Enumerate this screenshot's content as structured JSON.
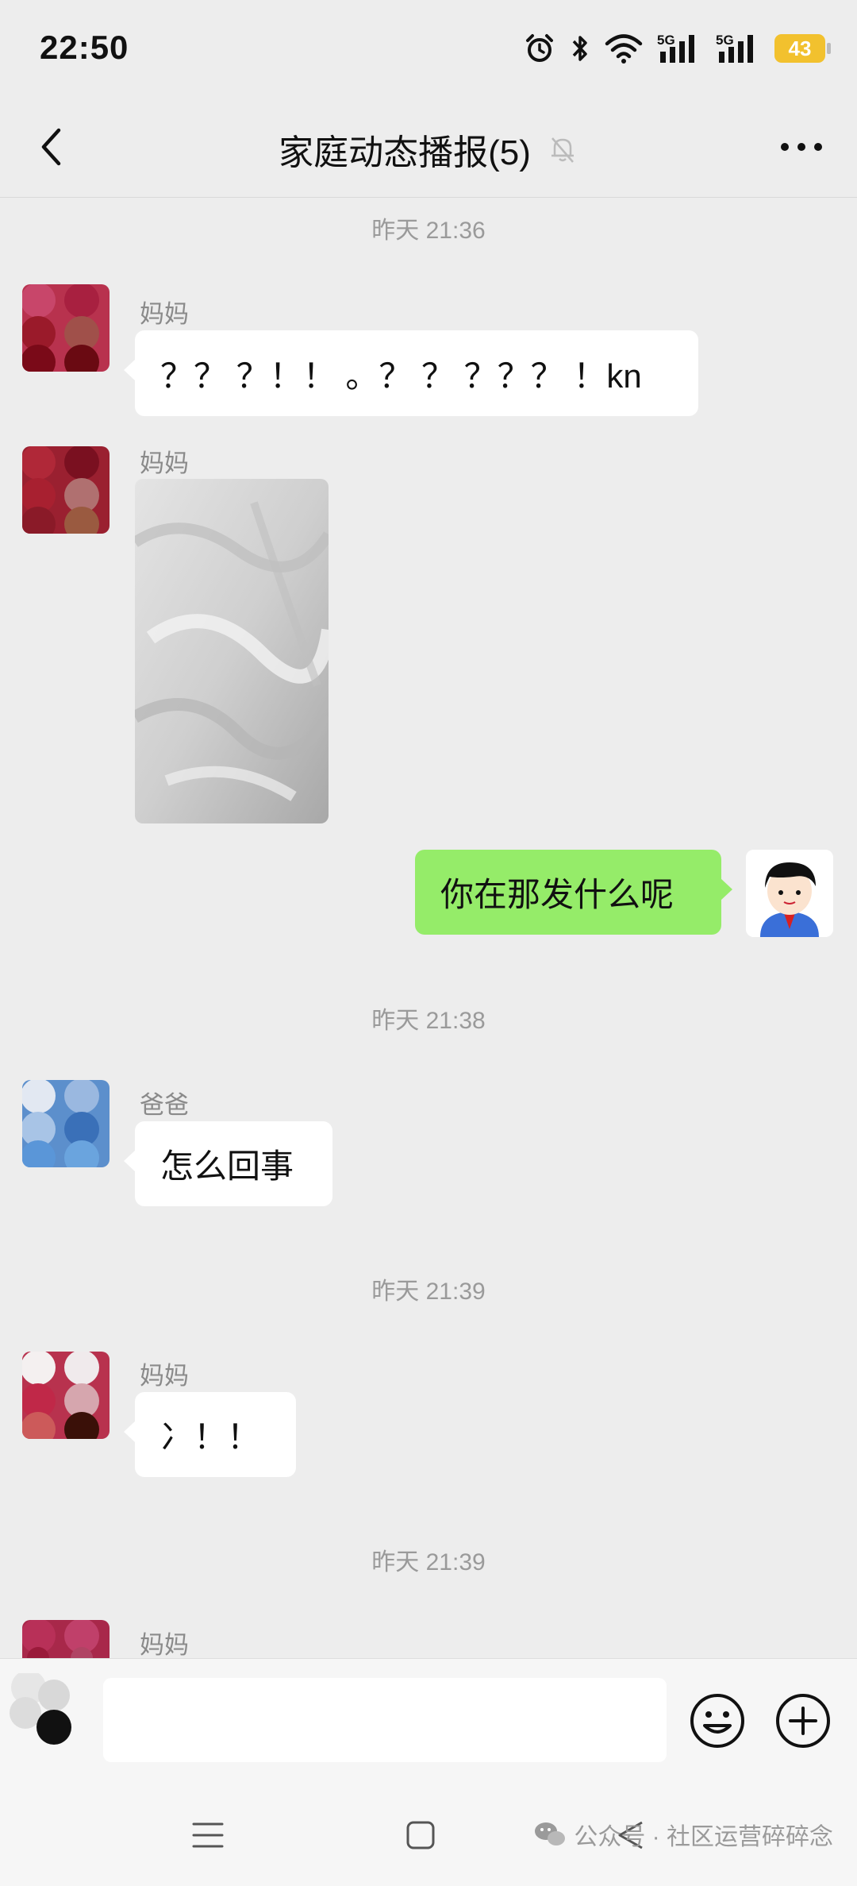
{
  "status_bar": {
    "time": "22:50",
    "net1": "5G",
    "net2": "5G",
    "battery": "43"
  },
  "header": {
    "title": "家庭动态播报(5)"
  },
  "messages": [
    {
      "type": "time",
      "text": "昨天 21:36"
    },
    {
      "type": "text",
      "side": "left",
      "sender": "妈妈",
      "text": "？？ ？！！ 。？ ？ ？？？ ！kn"
    },
    {
      "type": "image",
      "side": "left",
      "sender": "妈妈"
    },
    {
      "type": "text",
      "side": "right",
      "text": "你在那发什么呢"
    },
    {
      "type": "time",
      "text": "昨天 21:38"
    },
    {
      "type": "text",
      "side": "left",
      "sender": "爸爸",
      "text": "怎么回事"
    },
    {
      "type": "time",
      "text": "昨天 21:39"
    },
    {
      "type": "text",
      "side": "left",
      "sender": "妈妈",
      "text": "冫！！"
    },
    {
      "type": "time",
      "text": "昨天 21:39"
    },
    {
      "type": "partial",
      "side": "left",
      "sender": "妈妈"
    }
  ],
  "input": {
    "value": "",
    "emoji_icon": "emoji-icon",
    "plus_icon": "plus-circle-icon"
  },
  "watermark": "公众号 · 社区运营碎碎念",
  "colors": {
    "background": "#ededed",
    "my_bubble": "#95ec69",
    "other_bubble": "#ffffff",
    "battery": "#f2c12e"
  }
}
